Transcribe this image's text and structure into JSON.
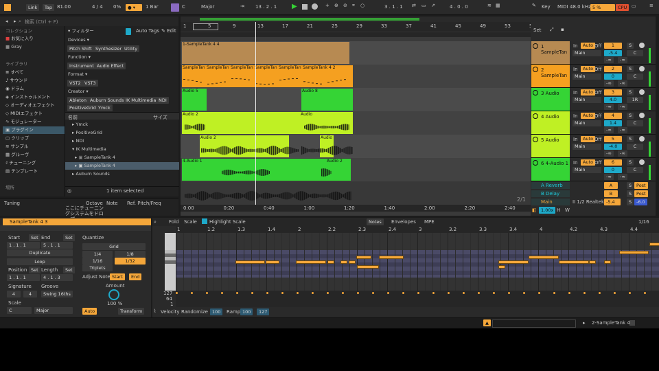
{
  "transport": {
    "link": "Link",
    "tap": "Tap",
    "tempo": "81.00",
    "signature": "4 / 4",
    "percent": "0%",
    "bar": "1 Bar",
    "key_root": "C",
    "scale": "Major",
    "arr_pos": "13 .   2 .   1",
    "loop_start": "3 .   1 .   1",
    "loop_len": "4 .   0 .   0",
    "key_label": "Key",
    "midi_label": "MIDI",
    "sample_rate": "48.0 kHz",
    "cpu_label": "CPU",
    "cpu_pct": "5 %"
  },
  "browser": {
    "search_placeholder": "検索 (Ctrl + F)",
    "collections_title": "コレクション",
    "collections": [
      "お気に入り",
      "Gray"
    ],
    "library_title": "ライブラリ",
    "library": [
      "すべて",
      "サウンド",
      "ドラム",
      "インストゥルメント",
      "オーディオエフェクト",
      "MIDIエフェクト",
      "モジュレーター",
      "プラグイン",
      "クリップ",
      "サンプル",
      "グルーヴ",
      "チューニング",
      "テンプレート"
    ],
    "places_title": "場所",
    "filter_label": "フィルター",
    "auto_tags": "Auto Tags",
    "edit": "Edit",
    "devices_label": "Devices ▾",
    "device_tags": [
      "Pitch Shift",
      "Synthesizer",
      "Utility"
    ],
    "function_label": "Function ▾",
    "function_tags": [
      "Instrument",
      "Audio Effect"
    ],
    "format_label": "Format ▾",
    "format_tags": [
      "VST2",
      "VST3"
    ],
    "creator_label": "Creator ▾",
    "creator_tags": [
      "Ableton",
      "Auburn Sounds",
      "IK Multimedia",
      "NDI",
      "PositiveGrid",
      "Ymck"
    ],
    "col_name": "名前",
    "col_size": "サイズ",
    "items": [
      "Ymck",
      "PositiveGrid",
      "NDI",
      "IK Multimedia",
      "SampleTank 4",
      "SampleTank 4",
      "Auburn Sounds"
    ],
    "status": "1 item selected"
  },
  "info": {
    "title": "Tuning",
    "tabs": [
      "Octave",
      "Note",
      "Ref. Pitch/Freq"
    ],
    "text": "ここにチューニングシステムをドロップ"
  },
  "arrangement": {
    "bar_numbers": [
      "1",
      "5",
      "9",
      "13",
      "17",
      "21",
      "25",
      "29",
      "33",
      "37",
      "41",
      "45",
      "49",
      "53",
      "57"
    ],
    "set_label": "Set",
    "time_labels": [
      "0:00",
      "0:20",
      "0:40",
      "1:00",
      "1:20",
      "1:40",
      "2:00",
      "2:20",
      "2:40"
    ],
    "page": "2/1",
    "zoom": "1.00x",
    "H": "H",
    "W": "W"
  },
  "clips": {
    "c1": "1-SampleTank 4 4",
    "c2": "SampleTan",
    "c2b": "SampleTan",
    "c2c": "SampleTan",
    "c2d": "SampleTan",
    "c2e": "SampleTank 4 2",
    "c3a": "Audio 5",
    "c3b": "Audio 8",
    "c4a": "Audio 2",
    "c4b": "Audio",
    "c5a": "Audio 2",
    "c5b": "Audio",
    "c6a": "4-Audio 1",
    "c6b": "Audio 2"
  },
  "tracks": [
    {
      "name": "1 SampleTan",
      "num": "1",
      "vol": "-5.4",
      "pan": "C",
      "color": "#b78a52"
    },
    {
      "name": "2 SampleTan",
      "num": "2",
      "vol": "0",
      "pan": "C",
      "color": "#f5a020"
    },
    {
      "name": "3 Audio",
      "num": "3",
      "vol": "4.0",
      "pan": "1R",
      "color": "#35d435"
    },
    {
      "name": "4 Audio",
      "num": "4",
      "vol": "1.4",
      "pan": "C",
      "color": "#bff024"
    },
    {
      "name": "5 Audio",
      "num": "5",
      "vol": "-4.0",
      "pan": "C",
      "color": "#bff024"
    },
    {
      "name": "6 4-Audio 1",
      "num": "6",
      "vol": "0",
      "pan": "C",
      "color": "#35d435"
    }
  ],
  "returns": [
    {
      "name": "A Reverb",
      "letter": "A",
      "post": "Post"
    },
    {
      "name": "B Delay",
      "letter": "B",
      "post": "Post"
    }
  ],
  "main": {
    "name": "Main",
    "routing": "II 1/2 Realtek",
    "vol": "-5.4",
    "vol2": "-6.0"
  },
  "mixer": {
    "in": "In",
    "auto": "Auto",
    "off": "Off",
    "main": "Main",
    "inf": "-∞",
    "S": "S"
  },
  "clipview": {
    "title": "SampleTank 4 3",
    "start": "Start",
    "end": "End",
    "set": "Set",
    "start_val": "1 .   1 .   1",
    "end_val": "5 .   1 .   1",
    "duplicate": "Duplicate",
    "loop": "Loop",
    "position": "Position",
    "length": "Length",
    "pos_val": "1 .   1 .   1",
    "len_val": "4 .   1 .   3",
    "signature": "Signature",
    "groove": "Groove",
    "sig_num": "4",
    "sig_den": "4",
    "swing": "Swing 16ths",
    "scale": "Scale",
    "scale_root": "C",
    "scale_name": "Major",
    "quantize": "Quantize",
    "grid": "Grid",
    "q_opts": [
      "1/4",
      "1/8",
      "1/16",
      "1/32"
    ],
    "triplets": "Triplets",
    "adjust_note": "Adjust Note",
    "q_start": "Start",
    "q_end": "End",
    "amount": "Amount",
    "amount_val": "100 %",
    "auto": "Auto",
    "transform": "Transform"
  },
  "editor": {
    "fold": "Fold",
    "scale": "Scale",
    "highlight": "Highlight Scale",
    "tabs": [
      "Notes",
      "Envelopes",
      "MPE"
    ],
    "grid": "1/16",
    "ruler": [
      "1",
      "1.2",
      "1.3",
      "1.4",
      "2",
      "2.2",
      "2.3",
      "2.4",
      "3",
      "3.2",
      "3.3",
      "3.4",
      "4",
      "4.2",
      "4.3",
      "4.4"
    ],
    "vel_labels": [
      "127",
      "64",
      "1"
    ],
    "velocity": "Velocity",
    "randomize": "Randomize",
    "rand_val": "100",
    "ramp": "Ramp",
    "ramp_a": "100",
    "ramp_b": "127"
  },
  "statusbar": {
    "track": "2-SampleTank 4"
  },
  "colors": {
    "accent": "#f5a73a",
    "cyan": "#1ea9c9",
    "green": "#35d435",
    "lime": "#bff024"
  }
}
